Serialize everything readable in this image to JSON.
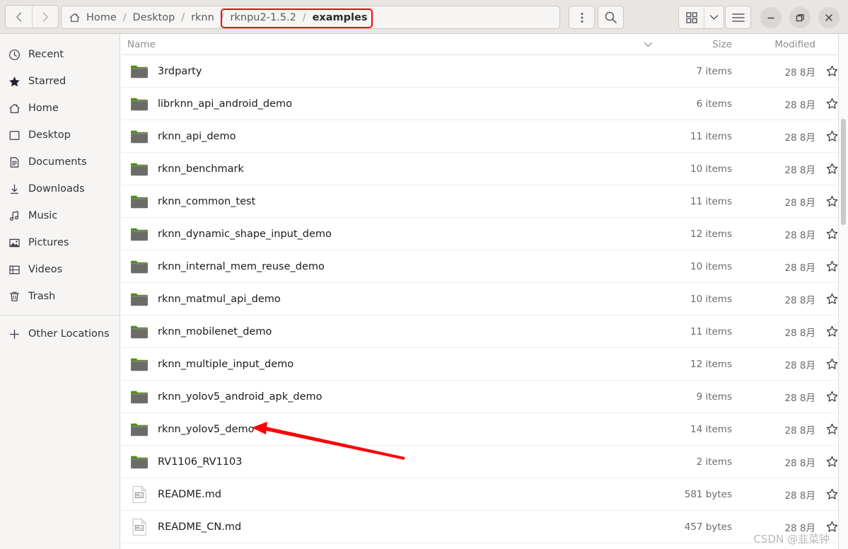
{
  "window": {
    "titlebar_color": "#e8e6e3",
    "accent_annotation_color": "#fb0007",
    "minimize_label": "—",
    "maximize_label": "❐",
    "close_label": "✕"
  },
  "nav": {
    "back_label": "‹",
    "forward_label": "›"
  },
  "breadcrumb": {
    "home_label": "Home",
    "separator": "/",
    "items": [
      {
        "label": "Home",
        "current": false
      },
      {
        "label": "Desktop",
        "current": false
      },
      {
        "label": "rknn",
        "current": false
      },
      {
        "label": "rknpu2-1.5.2",
        "current": false
      },
      {
        "label": "examples",
        "current": true
      }
    ]
  },
  "toolbar": {
    "menu_dots_label": "⋮",
    "search_label": "search-icon",
    "grid_view_label": "grid-icon",
    "view_dropdown_label": "∨",
    "hamburger_label": "≡"
  },
  "sidebar": {
    "items": [
      {
        "label": "Recent",
        "icon": "clock-icon"
      },
      {
        "label": "Starred",
        "icon": "star-filled-icon"
      },
      {
        "label": "Home",
        "icon": "home-icon"
      },
      {
        "label": "Desktop",
        "icon": "desktop-icon"
      },
      {
        "label": "Documents",
        "icon": "documents-icon"
      },
      {
        "label": "Downloads",
        "icon": "download-icon"
      },
      {
        "label": "Music",
        "icon": "music-icon"
      },
      {
        "label": "Pictures",
        "icon": "pictures-icon"
      },
      {
        "label": "Videos",
        "icon": "videos-icon"
      },
      {
        "label": "Trash",
        "icon": "trash-icon"
      }
    ],
    "other_locations": {
      "label": "Other Locations",
      "icon": "plus-icon"
    }
  },
  "columns": {
    "name": "Name",
    "size": "Size",
    "modified": "Modified",
    "sort_indicator": "∨"
  },
  "files": [
    {
      "name": "3rdparty",
      "type": "folder",
      "size": "7 items",
      "modified": "28 8月"
    },
    {
      "name": "librknn_api_android_demo",
      "type": "folder",
      "size": "6 items",
      "modified": "28 8月"
    },
    {
      "name": "rknn_api_demo",
      "type": "folder",
      "size": "11 items",
      "modified": "28 8月"
    },
    {
      "name": "rknn_benchmark",
      "type": "folder",
      "size": "10 items",
      "modified": "28 8月"
    },
    {
      "name": "rknn_common_test",
      "type": "folder",
      "size": "11 items",
      "modified": "28 8月"
    },
    {
      "name": "rknn_dynamic_shape_input_demo",
      "type": "folder",
      "size": "12 items",
      "modified": "28 8月"
    },
    {
      "name": "rknn_internal_mem_reuse_demo",
      "type": "folder",
      "size": "10 items",
      "modified": "28 8月"
    },
    {
      "name": "rknn_matmul_api_demo",
      "type": "folder",
      "size": "10 items",
      "modified": "28 8月"
    },
    {
      "name": "rknn_mobilenet_demo",
      "type": "folder",
      "size": "11 items",
      "modified": "28 8月"
    },
    {
      "name": "rknn_multiple_input_demo",
      "type": "folder",
      "size": "12 items",
      "modified": "28 8月"
    },
    {
      "name": "rknn_yolov5_android_apk_demo",
      "type": "folder",
      "size": "9 items",
      "modified": "28 8月"
    },
    {
      "name": "rknn_yolov5_demo",
      "type": "folder",
      "size": "14 items",
      "modified": "28 8月"
    },
    {
      "name": "RV1106_RV1103",
      "type": "folder",
      "size": "2 items",
      "modified": "28 8月"
    },
    {
      "name": "README.md",
      "type": "markdown",
      "size": "581 bytes",
      "modified": "28 8月"
    },
    {
      "name": "README_CN.md",
      "type": "markdown",
      "size": "457 bytes",
      "modified": "28 8月"
    }
  ],
  "annotations": {
    "breadcrumb_highlight": "rknpu2-1.5.2 / examples",
    "arrow_target": "rknn_yolov5_demo"
  },
  "watermark": {
    "text": "CSDN @韭菜钟"
  }
}
